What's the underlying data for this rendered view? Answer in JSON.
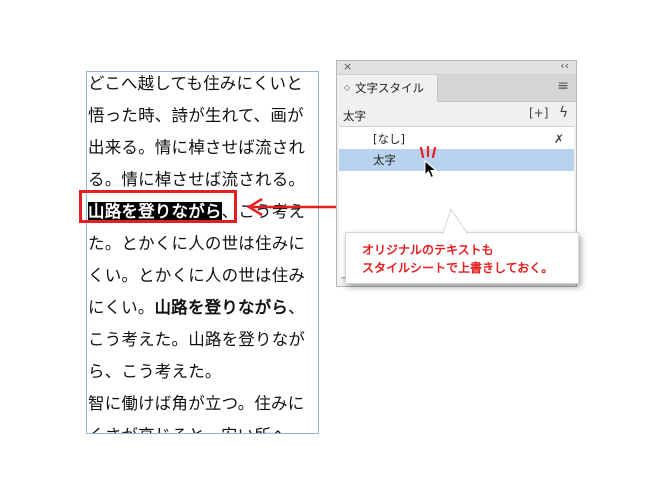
{
  "text_frame": {
    "lines": [
      {
        "parts": [
          {
            "text": "どこへ越しても住みにくいと",
            "style": "n"
          }
        ]
      },
      {
        "parts": [
          {
            "text": "悟った時、詩が生れて、画が",
            "style": "n"
          }
        ]
      },
      {
        "parts": [
          {
            "text": "出来る。情に棹させば流され",
            "style": "n"
          }
        ]
      },
      {
        "parts": [
          {
            "text": "る。情に棹させば流される。",
            "style": "n"
          }
        ]
      },
      {
        "parts": [
          {
            "text": "山路を登りながら",
            "style": "sel"
          },
          {
            "text": "、こう考え",
            "style": "n"
          }
        ]
      },
      {
        "parts": [
          {
            "text": "た。とかくに人の世は住みに",
            "style": "n"
          }
        ]
      },
      {
        "parts": [
          {
            "text": "くい。とかくに人の世は住み",
            "style": "n"
          }
        ]
      },
      {
        "parts": [
          {
            "text": "にくい。",
            "style": "n"
          },
          {
            "text": "山路を登りながら",
            "style": "b"
          },
          {
            "text": "、",
            "style": "n"
          }
        ]
      },
      {
        "parts": [
          {
            "text": "こう考えた。山路を登りなが",
            "style": "n"
          }
        ]
      },
      {
        "parts": [
          {
            "text": "ら、こう考えた。",
            "style": "n"
          }
        ]
      },
      {
        "parts": [
          {
            "text": "智に働けば角が立つ。住みに",
            "style": "n"
          }
        ]
      },
      {
        "parts": [
          {
            "text": "くさが高じると、安い所へ",
            "style": "n"
          }
        ]
      }
    ]
  },
  "panel": {
    "close_glyph": "×",
    "collapse_glyph": "‹‹",
    "tab_arrows": "◇",
    "tab_label": "文字スタイル",
    "menu_glyph": "≡",
    "current_style": "太字",
    "new_style_glyph": "[+]",
    "quick_apply_glyph": "ϟ",
    "styles": [
      "[なし]",
      "太字"
    ],
    "clear_glyph": "✗",
    "footer_glyph": "→"
  },
  "callout": {
    "line1": "オリジナルのテキストも",
    "line2": "スタイルシートで上書きしておく。"
  },
  "colors": {
    "accent_red": "#e51f1f",
    "selection_row": "#b9d3ee",
    "frame_border": "#8fb6de"
  },
  "icons": {
    "cursor": "arrow-cursor-icon",
    "click": "click-marks-icon"
  }
}
